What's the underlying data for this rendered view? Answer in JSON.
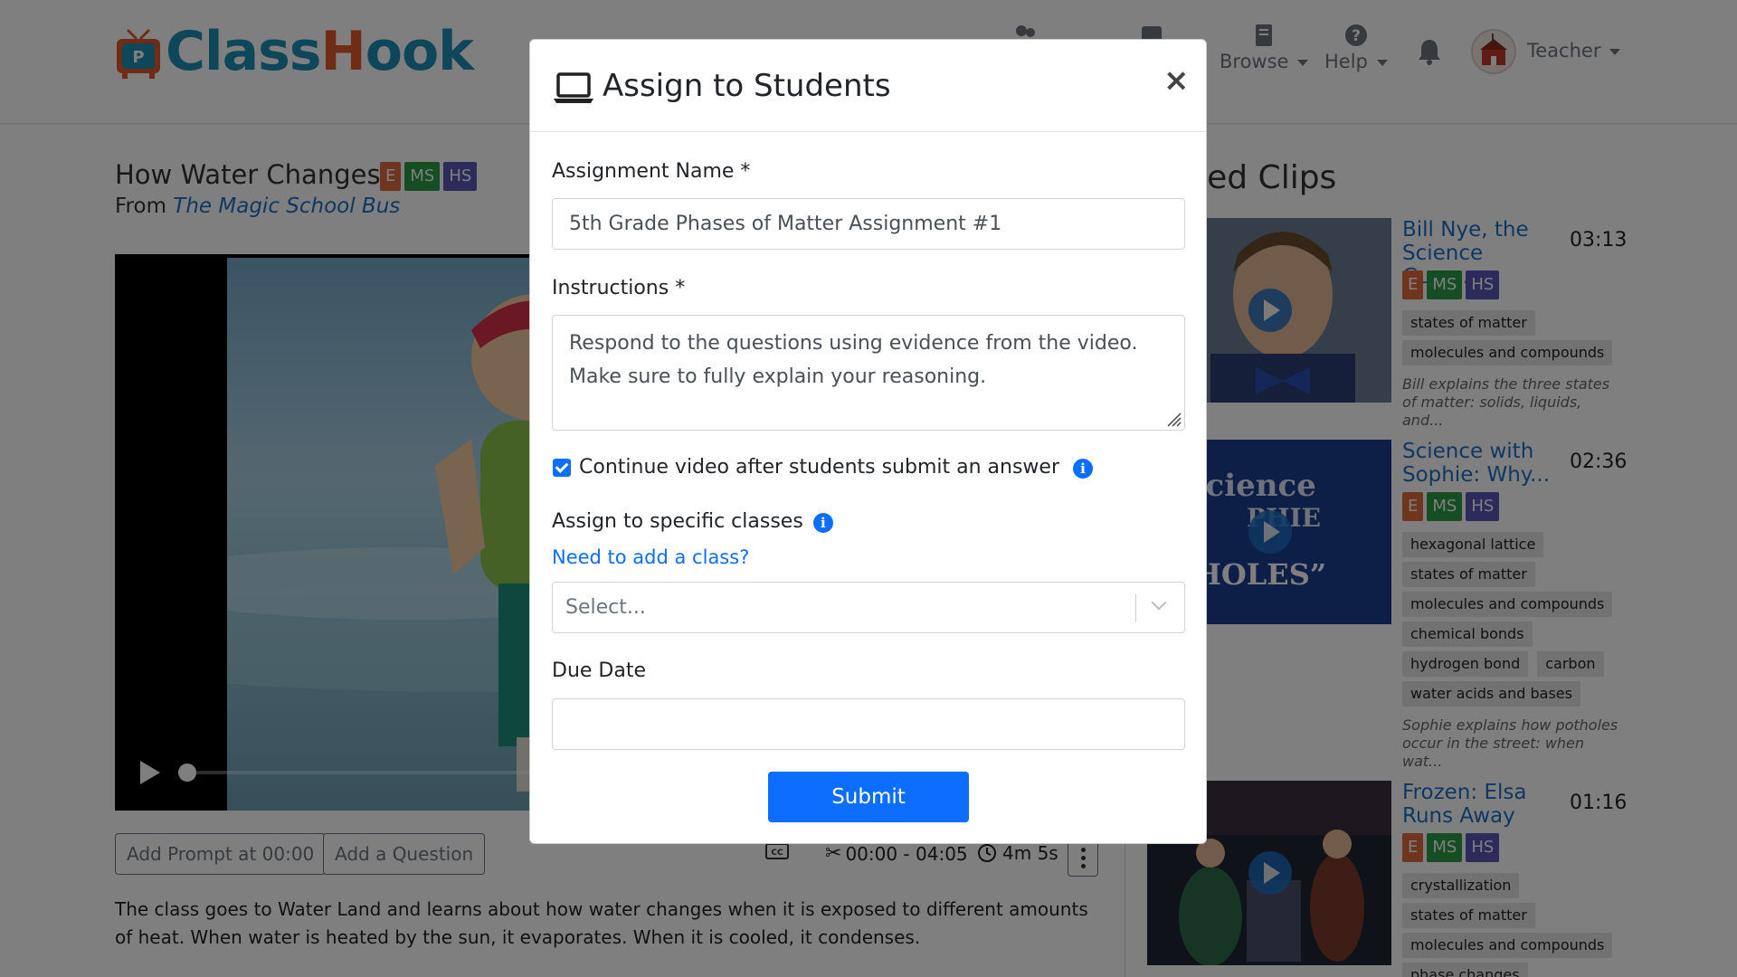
{
  "navbar": {
    "logo_text_part1": "Class",
    "logo_text_part2": "H",
    "logo_text_part3": "ook",
    "browse_label": "Browse",
    "help_label": "Help",
    "user_label": "Teacher"
  },
  "clip": {
    "title": "How Water Changes",
    "badges": [
      "E",
      "MS",
      "HS"
    ],
    "from_prefix": "From",
    "source": "The Magic School Bus",
    "add_prompt_label": "Add Prompt at 00:00",
    "add_question_label": "Add a Question",
    "time_range": "00:00 - 04:05",
    "duration": "4m 5s",
    "description": "The class goes to Water Land and learns about how water changes when it is exposed to different amounts of heat. When water is heated by the sun, it evaporates. When it is cooled, it condenses."
  },
  "related": {
    "title_visible": "ted Clips",
    "items": [
      {
        "name": "Bill Nye, the Science Guy:...",
        "time": "03:13",
        "badges": [
          "E",
          "MS",
          "HS"
        ],
        "tags": [
          "states of matter",
          "molecules and compounds"
        ],
        "desc": "Bill explains the three states of matter: solids, liquids, and..."
      },
      {
        "name": "Science with Sophie: Why...",
        "time": "02:36",
        "badges": [
          "E",
          "MS",
          "HS"
        ],
        "tags": [
          "hexagonal lattice",
          "states of matter",
          "molecules and compounds",
          "chemical bonds",
          "hydrogen bond",
          "carbon",
          "water acids and bases"
        ],
        "desc": "Sophie explains how potholes occur in the street: when wat...",
        "thumb_text_1": "Science",
        "thumb_text_2": "PHIE",
        "thumb_text_3": "OTHOLES”"
      },
      {
        "name": "Frozen: Elsa Runs Away",
        "time": "01:16",
        "badges": [
          "E",
          "MS",
          "HS"
        ],
        "tags": [
          "crystallization",
          "states of matter",
          "molecules and compounds",
          "phase changes"
        ]
      }
    ]
  },
  "modal": {
    "title": "Assign to Students",
    "close": "×",
    "assignment_name_label": "Assignment Name *",
    "assignment_name_value": "5th Grade Phases of Matter Assignment #1",
    "instructions_label": "Instructions *",
    "instructions_line1": "Respond to the questions using evidence from the video.",
    "instructions_line2": "Make sure to fully explain your reasoning.",
    "continue_label": "Continue video after students submit an answer",
    "continue_checked": true,
    "classes_label": "Assign to specific classes",
    "add_class_link": "Need to add a class?",
    "select_placeholder": "Select...",
    "due_date_label": "Due Date",
    "due_date_value": "",
    "submit_label": "Submit"
  },
  "colors": {
    "primary": "#0d6efd",
    "brand_blue": "#1d8fb3",
    "brand_orange": "#e2582a",
    "badge_e": "#e06b3e",
    "badge_ms": "#2d9b46",
    "badge_hs": "#5a56b8"
  }
}
